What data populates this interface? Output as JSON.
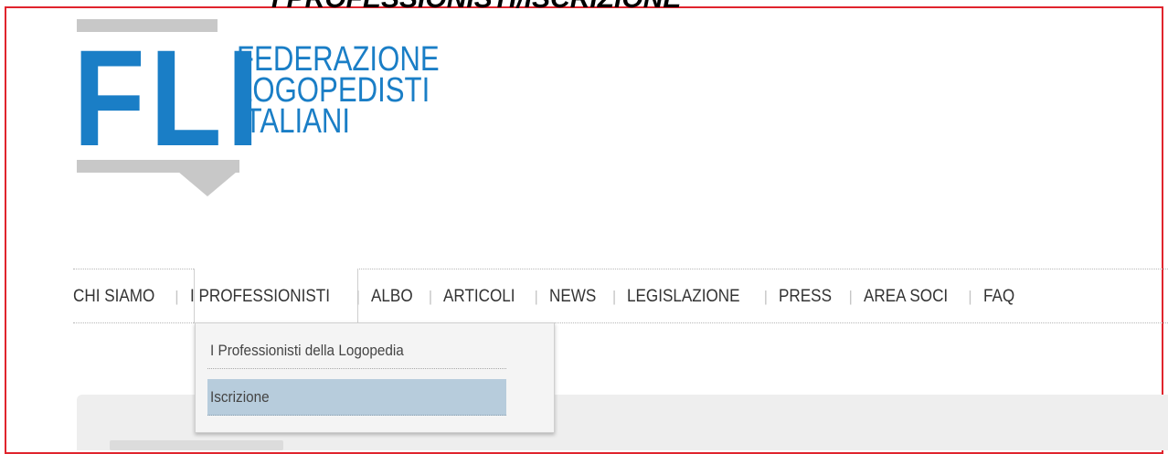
{
  "page": {
    "heading": "I PROFESSIONISTI/ISCRIZIONE"
  },
  "logo": {
    "letters": "FLI",
    "lines": [
      "FEDERAZIONE",
      "LOGOPEDISTI",
      "ITALIANI"
    ]
  },
  "nav": {
    "items": [
      {
        "label": "CHI SIAMO"
      },
      {
        "label": "I PROFESSIONISTI"
      },
      {
        "label": "ALBO"
      },
      {
        "label": "ARTICOLI"
      },
      {
        "label": "NEWS"
      },
      {
        "label": "LEGISLAZIONE"
      },
      {
        "label": "PRESS"
      },
      {
        "label": "AREA SOCI"
      },
      {
        "label": "FAQ"
      }
    ],
    "separator": "|",
    "active": "I PROFESSIONISTI"
  },
  "dropdown": {
    "items": [
      {
        "label": "I Professionisti della Logopedia"
      },
      {
        "label": "Iscrizione"
      }
    ],
    "highlighted": "Iscrizione"
  },
  "colors": {
    "brand_blue": "#1a7ec6",
    "logo_grey": "#c8c8c8",
    "frame_red": "#e0242d",
    "highlight": "#b7ccdc"
  }
}
